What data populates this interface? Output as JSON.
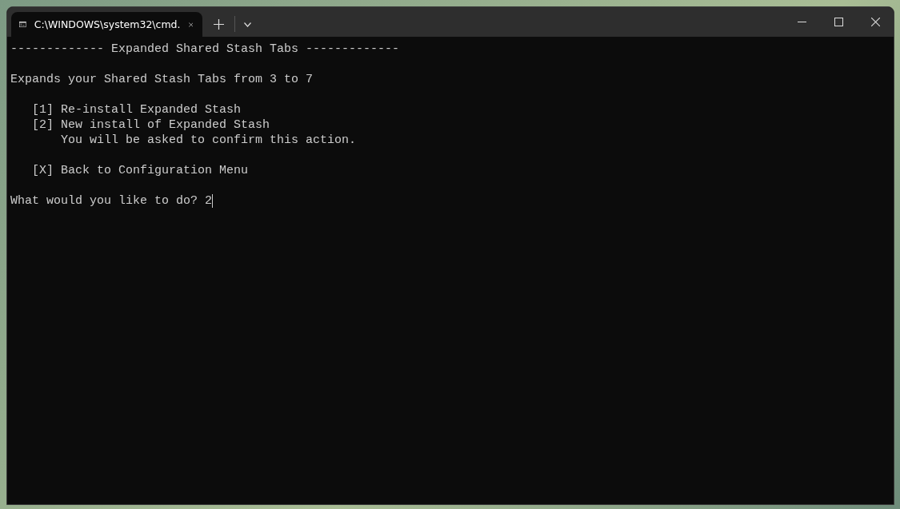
{
  "tabs": [
    {
      "title": "C:\\WINDOWS\\system32\\cmd.",
      "selected": true
    }
  ],
  "terminal": {
    "lines": [
      {
        "kind": "text",
        "text": "------------- Expanded Shared Stash Tabs -------------"
      },
      {
        "kind": "blank"
      },
      {
        "kind": "text",
        "text": "Expands your Shared Stash Tabs from 3 to 7"
      },
      {
        "kind": "blank"
      },
      {
        "kind": "option",
        "text": "[1] Re-install Expanded Stash"
      },
      {
        "kind": "option",
        "text": "[2] New install of Expanded Stash"
      },
      {
        "kind": "note",
        "text": "You will be asked to confirm this action."
      },
      {
        "kind": "blank"
      },
      {
        "kind": "option",
        "text": "[X] Back to Configuration Menu"
      },
      {
        "kind": "blank"
      },
      {
        "kind": "prompt",
        "text": "What would you like to do?",
        "value": "2"
      }
    ]
  }
}
